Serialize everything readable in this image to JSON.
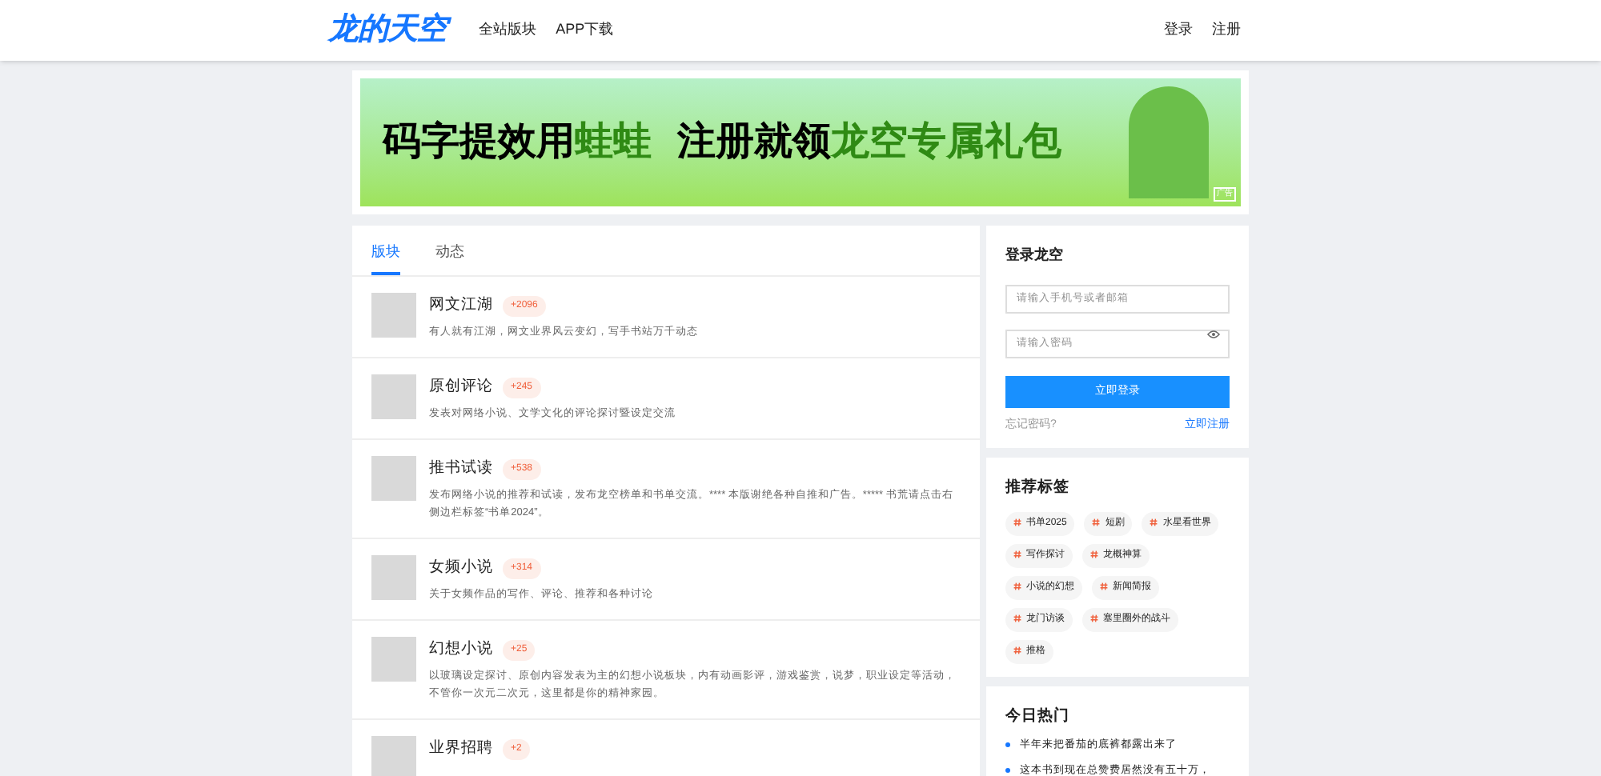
{
  "header": {
    "logo": "龙的天空",
    "nav": [
      {
        "label": "全站版块"
      },
      {
        "label": "APP下载"
      }
    ],
    "actions": [
      {
        "label": "登录"
      },
      {
        "label": "注册"
      }
    ]
  },
  "banner": {
    "parts": [
      {
        "text": "码字提效用",
        "kind": "plain"
      },
      {
        "text": "蛙蛙",
        "kind": "accent"
      },
      {
        "text": "注册就领",
        "kind": "plain"
      },
      {
        "text": "龙空专属礼包",
        "kind": "accent"
      }
    ],
    "badge": "广告"
  },
  "tabs": [
    {
      "label": "版块",
      "selected": true
    },
    {
      "label": "动态",
      "selected": false
    }
  ],
  "boards": [
    {
      "name": "网文江湖",
      "count": "+2096",
      "desc": "有人就有江湖，网文业界风云变幻，写手书站万千动态"
    },
    {
      "name": "原创评论",
      "count": "+245",
      "desc": "发表对网络小说、文学文化的评论探讨暨设定交流"
    },
    {
      "name": "推书试读",
      "count": "+538",
      "desc": "发布网络小说的推荐和试读，发布龙空榜单和书单交流。**** 本版谢绝各种自推和广告。***** 书荒请点击右侧边栏标签“书单2024”。"
    },
    {
      "name": "女频小说",
      "count": "+314",
      "desc": "关于女频作品的写作、评论、推荐和各种讨论"
    },
    {
      "name": "幻想小说",
      "count": "+25",
      "desc": "以玻璃设定探讨、原创内容发表为主的幻想小说板块，内有动画影评，游戏鉴赏，说梦，职业设定等活动，不管你一次元二次元，这里都是你的精神家园。"
    },
    {
      "name": "业界招聘",
      "count": "+2"
    }
  ],
  "login": {
    "title": "登录龙空",
    "account_placeholder": "请输入手机号或者邮箱",
    "password_placeholder": "请输入密码",
    "submit": "立即登录",
    "forgot": "忘记密码?",
    "register": "立即注册"
  },
  "tags": {
    "title": "推荐标签",
    "items": [
      "书单2025",
      "短剧",
      "水星看世界",
      "写作探讨",
      "龙概神算",
      "小说的幻想",
      "新闻简报",
      "龙门访谈",
      "塞里圈外的战斗",
      "推格"
    ]
  },
  "hot": {
    "title": "今日热门",
    "items": [
      "半年来把番茄的底裤都露出来了",
      "这本书到现在总赞费居然没有五十万，"
    ]
  }
}
